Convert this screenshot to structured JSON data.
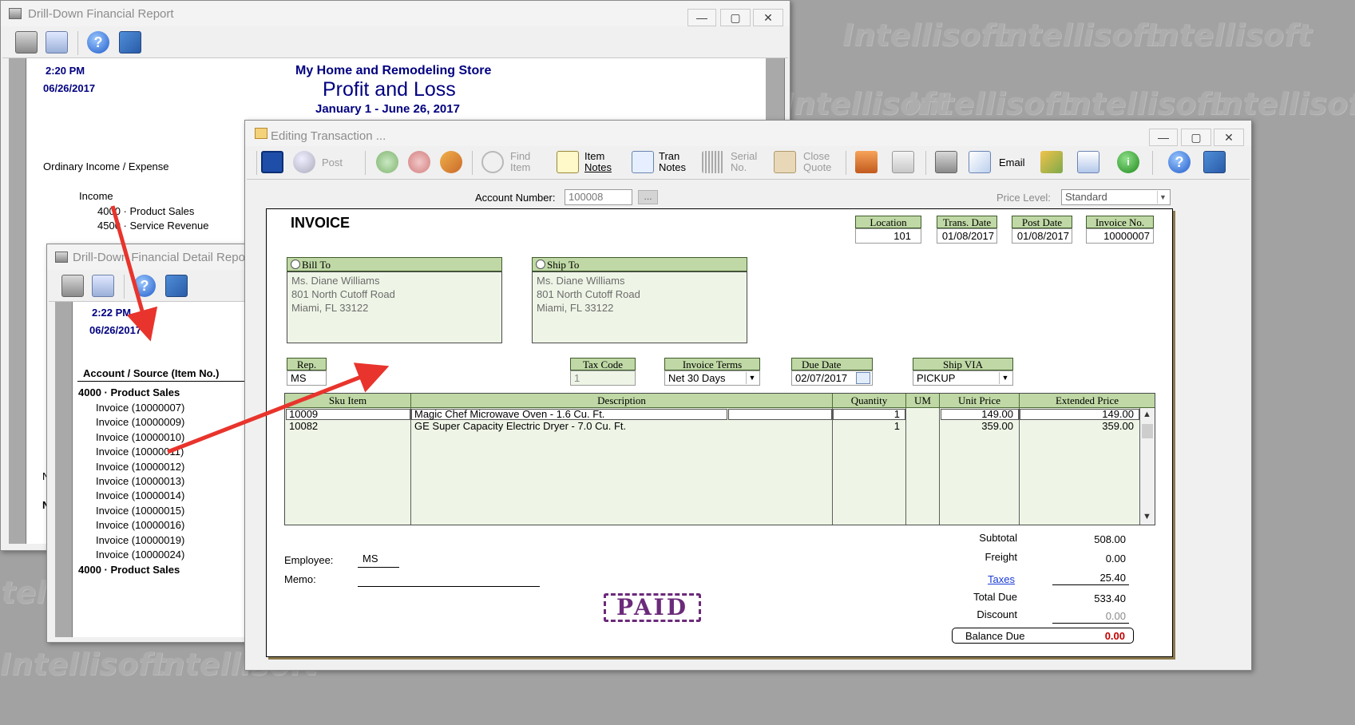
{
  "watermark": "Intellisoft",
  "report_window": {
    "title": "Drill-Down Financial Report",
    "time": "2:20 PM",
    "date": "06/26/2017",
    "company": "My Home and Remodeling Store",
    "report_title": "Profit and Loss",
    "period": "January 1 - June 26, 2017",
    "section": "Ordinary Income / Expense",
    "group": "Income",
    "rows": [
      "4000 · Product Sales",
      "4500 · Service Revenue"
    ],
    "partial_n1": "N",
    "partial_n2": "N"
  },
  "detail_window": {
    "title": "Drill-Down Financial Detail Report",
    "time": "2:22 PM",
    "date": "06/26/2017",
    "column_header": "Account / Source (Item No.)",
    "group_header": "4000 · Product Sales",
    "rows": [
      "Invoice (10000007)",
      "Invoice (10000009)",
      "Invoice (10000010)",
      "Invoice (10000011)",
      "Invoice (10000012)",
      "Invoice (10000013)",
      "Invoice (10000014)",
      "Invoice (10000015)",
      "Invoice (10000016)",
      "Invoice (10000019)",
      "Invoice (10000024)"
    ],
    "group_footer": "4000 · Product Sales"
  },
  "editor": {
    "title": "Editing Transaction ...",
    "toolbar": {
      "post": "Post",
      "find_item_1": "Find",
      "find_item_2": "Item",
      "item_notes_1": "Item",
      "item_notes_2": "Notes",
      "tran_notes_1": "Tran",
      "tran_notes_2": "Notes",
      "serial_1": "Serial",
      "serial_2": "No.",
      "close_quote_1": "Close",
      "close_quote_2": "Quote",
      "email": "Email"
    },
    "account_number_label": "Account Number:",
    "account_number": "100008",
    "ellipsis_button": "...",
    "price_level_label": "Price Level:",
    "price_level": "Standard",
    "invoice_label": "INVOICE",
    "header_fields": [
      {
        "label": "Location",
        "value": "101"
      },
      {
        "label": "Trans. Date",
        "value": "01/08/2017"
      },
      {
        "label": "Post Date",
        "value": "01/08/2017"
      },
      {
        "label": "Invoice No.",
        "value": "10000007"
      }
    ],
    "bill_to": {
      "label": "Bill To",
      "lines": [
        "Ms. Diane Williams",
        "801 North Cutoff Road",
        "Miami, FL 33122"
      ]
    },
    "ship_to": {
      "label": "Ship To",
      "lines": [
        "Ms. Diane Williams",
        "801 North Cutoff Road",
        "Miami, FL 33122"
      ]
    },
    "rep_label": "Rep.",
    "rep_value": "MS",
    "tax_code_label": "Tax Code",
    "tax_code_value": "1",
    "terms_label": "Invoice Terms",
    "terms_value": "Net 30 Days",
    "due_date_label": "Due Date",
    "due_date_value": "02/07/2017",
    "ship_via_label": "Ship VIA",
    "ship_via_value": "PICKUP",
    "grid_headers": [
      "Sku Item",
      "Description",
      "Quantity",
      "UM",
      "Unit Price",
      "Extended Price"
    ],
    "lines": [
      {
        "sku": "10009",
        "desc": "Magic Chef Microwave Oven - 1.6 Cu. Ft.",
        "qty": "1",
        "um": "",
        "unit": "149.00",
        "ext": "149.00"
      },
      {
        "sku": "10082",
        "desc": "GE Super Capacity Electric Dryer - 7.0 Cu. Ft.",
        "qty": "1",
        "um": "",
        "unit": "359.00",
        "ext": "359.00"
      }
    ],
    "employee_label": "Employee:",
    "employee_value": "MS",
    "memo_label": "Memo:",
    "stamp": "PAID",
    "totals": {
      "subtotal_label": "Subtotal",
      "subtotal": "508.00",
      "freight_label": "Freight",
      "freight": "0.00",
      "taxes_label": "Taxes",
      "taxes": "25.40",
      "total_due_label": "Total Due",
      "total_due": "533.40",
      "discount_label": "Discount",
      "discount": "0.00",
      "balance_label": "Balance Due",
      "balance": "0.00"
    }
  },
  "colors": {
    "green_header": "#bfd8a5",
    "navy_text": "#000080",
    "balance_red": "#c00000",
    "stamp_purple": "#6b2a7a",
    "arrow_red": "#e8342c"
  }
}
